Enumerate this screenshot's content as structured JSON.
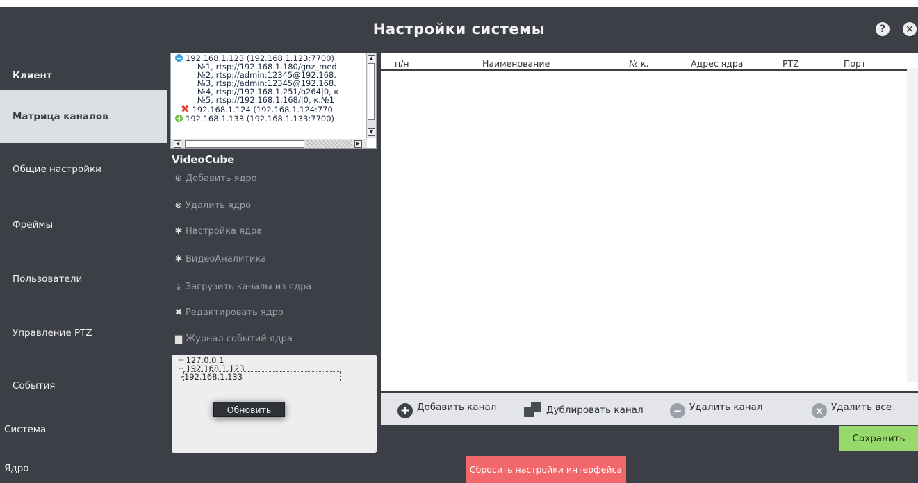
{
  "title": "Настройки системы",
  "sidebar": {
    "items": [
      {
        "label": "Клиент"
      },
      {
        "label": "Матрица каналов"
      },
      {
        "label": "Общие настройки"
      },
      {
        "label": "Фреймы"
      },
      {
        "label": "Пользователи"
      },
      {
        "label": "Управление PTZ"
      },
      {
        "label": "События"
      },
      {
        "label": "Система"
      },
      {
        "label": "Ядро"
      }
    ]
  },
  "tree": {
    "lines": [
      {
        "text": "192.168.1.123 (192.168.1.123:7700)",
        "icon": "minus-circle-icon"
      },
      {
        "text": "№1, rtsp://192.168.1.180/gnz_med"
      },
      {
        "text": "№2, rtsp://admin:12345@192.168."
      },
      {
        "text": "№3, rtsp://admin:12345@192.168."
      },
      {
        "text": "№4, rtsp://192.168.1.251/h264|0, к"
      },
      {
        "text": "№5, rtsp://192.168.1.168/|0, к.№1"
      },
      {
        "text": "192.168.1.124 (192.168.1.124:770",
        "icon": "red-cross-icon"
      },
      {
        "text": "192.168.1.133 (192.168.1.133:7700)",
        "icon": "plus-circle-icon"
      }
    ]
  },
  "videocube": {
    "title": "VideoCube",
    "actions": [
      {
        "label": "Добавить ядро",
        "icon": "add-circle-icon"
      },
      {
        "label": "Удалить ядро",
        "icon": "remove-circle-icon"
      },
      {
        "label": "Настройка ядра",
        "icon": "gear-icon"
      },
      {
        "label": "ВидеоАналитика",
        "icon": "gear-icon"
      },
      {
        "label": "Загрузить каналы из ядра",
        "icon": "download-icon"
      },
      {
        "label": "Редактировать ядро",
        "icon": "tools-icon"
      },
      {
        "label": "Журнал событий ядра",
        "icon": "journal-icon"
      }
    ]
  },
  "cores": {
    "items": [
      "127.0.0.1",
      "192.168.1.123",
      "192.168.1.133"
    ],
    "selected": "192.168.1.133",
    "refresh_label": "Обновить"
  },
  "table": {
    "columns": [
      "п/н",
      "Наименование",
      "№ к.",
      "Адрес ядра",
      "PTZ",
      "Порт"
    ],
    "rows": []
  },
  "actions": {
    "add_channel": "Добавить канал",
    "duplicate_channel": "Дублировать канал",
    "delete_channel": "Удалить канал",
    "delete_all": "Удалить все"
  },
  "save_label": "Сохранить",
  "reset_label": "Сбросить настройки интерфейса",
  "colors": {
    "background": "#3c3f45",
    "active_sidebar": "#dcdfe4",
    "save_button": "#97d96a",
    "reset_button": "#f2676c"
  }
}
